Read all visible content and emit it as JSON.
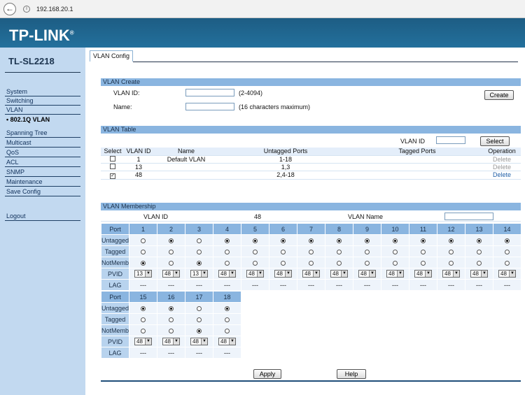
{
  "browser": {
    "url": "192.168.20.1",
    "back_icon": "←",
    "info_icon": "i"
  },
  "brand": {
    "logo": "TP-LINK",
    "logo_mark": "®",
    "model": "TL-SL2218"
  },
  "nav": {
    "items": [
      "System",
      "Switching",
      "VLAN",
      "• 802.1Q VLAN",
      "Spanning Tree",
      "Multicast",
      "QoS",
      "ACL",
      "SNMP",
      "Maintenance",
      "Save Config"
    ],
    "logout": "Logout"
  },
  "tab": "VLAN Config",
  "vlan_create": {
    "title": "VLAN Create",
    "vlan_id_label": "VLAN ID:",
    "vlan_id_hint": "(2-4094)",
    "vlan_id_value": "",
    "name_label": "Name:",
    "name_hint": "(16 characters maximum)",
    "name_value": "",
    "create_button": "Create"
  },
  "vlan_table": {
    "title": "VLAN Table",
    "search_label": "VLAN ID",
    "search_value": "",
    "select_button": "Select",
    "headers": [
      "Select",
      "VLAN ID",
      "Name",
      "Untagged Ports",
      "Tagged Ports",
      "Operation"
    ],
    "rows": [
      {
        "checked": "",
        "id": "1",
        "name": "Default VLAN",
        "untagged": "1-18",
        "tagged": "",
        "op": "Delete"
      },
      {
        "checked": "",
        "id": "13",
        "name": "",
        "untagged": "1,3",
        "tagged": "",
        "op": "Delete"
      },
      {
        "checked": "✓",
        "id": "48",
        "name": "",
        "untagged": "2,4-18",
        "tagged": "",
        "op": "Delete"
      }
    ]
  },
  "membership": {
    "title": "VLAN Membership",
    "vlan_id_label": "VLAN ID",
    "vlan_id_value": "48",
    "vlan_name_label": "VLAN Name",
    "vlan_name_value": "",
    "row_labels": [
      "Port",
      "Untagged",
      "Tagged",
      "NotMember",
      "PVID",
      "LAG"
    ],
    "ports": [
      {
        "port": "1",
        "mode": "NotMember",
        "pvid": "13",
        "lag": "---"
      },
      {
        "port": "2",
        "mode": "Untagged",
        "pvid": "48",
        "lag": "---"
      },
      {
        "port": "3",
        "mode": "NotMember",
        "pvid": "13",
        "lag": "---"
      },
      {
        "port": "4",
        "mode": "Untagged",
        "pvid": "48",
        "lag": "---"
      },
      {
        "port": "5",
        "mode": "Untagged",
        "pvid": "48",
        "lag": "---"
      },
      {
        "port": "6",
        "mode": "Untagged",
        "pvid": "48",
        "lag": "---"
      },
      {
        "port": "7",
        "mode": "Untagged",
        "pvid": "48",
        "lag": "---"
      },
      {
        "port": "8",
        "mode": "Untagged",
        "pvid": "48",
        "lag": "---"
      },
      {
        "port": "9",
        "mode": "Untagged",
        "pvid": "48",
        "lag": "---"
      },
      {
        "port": "10",
        "mode": "Untagged",
        "pvid": "48",
        "lag": "---"
      },
      {
        "port": "11",
        "mode": "Untagged",
        "pvid": "48",
        "lag": "---"
      },
      {
        "port": "12",
        "mode": "Untagged",
        "pvid": "48",
        "lag": "---"
      },
      {
        "port": "13",
        "mode": "Untagged",
        "pvid": "48",
        "lag": "---"
      },
      {
        "port": "14",
        "mode": "Untagged",
        "pvid": "48",
        "lag": "---"
      },
      {
        "port": "15",
        "mode": "Untagged",
        "pvid": "48",
        "lag": "---"
      },
      {
        "port": "16",
        "mode": "Untagged",
        "pvid": "48",
        "lag": "---"
      },
      {
        "port": "17",
        "mode": "NotMember",
        "pvid": "48",
        "lag": "---"
      },
      {
        "port": "18",
        "mode": "Untagged",
        "pvid": "48",
        "lag": "---"
      }
    ]
  },
  "actions": {
    "apply": "Apply",
    "help": "Help"
  },
  "colors": {
    "brand_bar": "#1d5d84",
    "sidebar": "#c2d9f0",
    "section_header": "#8ab5e0",
    "delete_active": "#1f5fa8"
  }
}
